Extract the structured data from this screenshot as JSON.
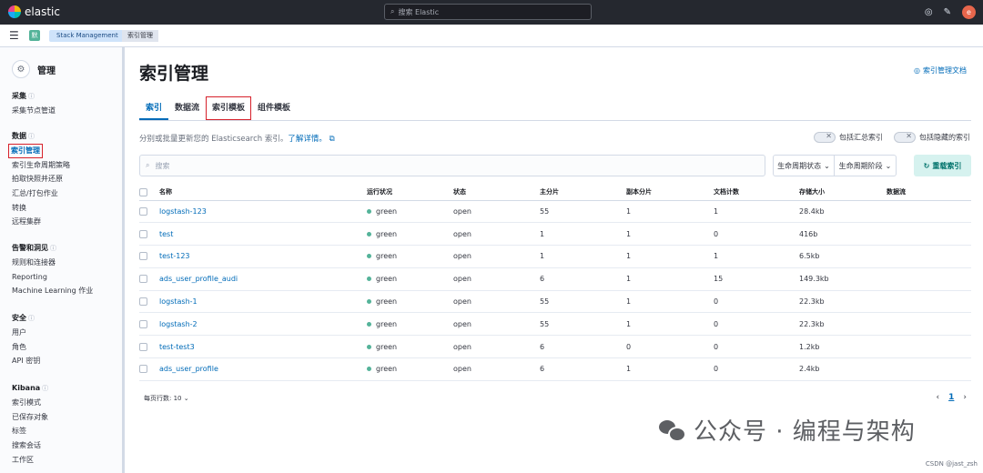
{
  "topbar": {
    "brand": "elastic",
    "search_placeholder": "搜索 Elastic",
    "avatar_letter": "e"
  },
  "breadcrumbs": {
    "space_badge": "默",
    "items": [
      "Stack Management",
      "索引管理"
    ]
  },
  "sidebar": {
    "title": "管理",
    "groups": [
      {
        "title": "采集",
        "items": [
          "采集节点管道"
        ]
      },
      {
        "title": "数据",
        "items": [
          "索引管理",
          "索引生命周期策略",
          "拍取快照并还原",
          "汇总/打包作业",
          "转换",
          "远程集群"
        ]
      },
      {
        "title": "告警和洞见",
        "items": [
          "规则和连接器",
          "Reporting",
          "Machine Learning 作业"
        ]
      },
      {
        "title": "安全",
        "items": [
          "用户",
          "角色",
          "API 密钥"
        ]
      },
      {
        "title": "Kibana",
        "items": [
          "索引模式",
          "已保存对象",
          "标签",
          "搜索会话",
          "工作区"
        ]
      }
    ]
  },
  "main": {
    "title": "索引管理",
    "doc_link": "索引管理文档",
    "tabs": [
      "索引",
      "数据流",
      "索引模板",
      "组件模板"
    ],
    "description": "分别或批量更新您的 Elasticsearch 索引。",
    "learn_more": "了解详情。",
    "toggle_rollup": "包括汇总索引",
    "toggle_hidden": "包括隐藏的索引",
    "search_placeholder": "搜索",
    "filter_phase": "生命周期状态",
    "filter_stage": "生命周期阶段",
    "reload_button": "重载索引"
  },
  "table": {
    "columns": [
      "名称",
      "运行状况",
      "状态",
      "主分片",
      "副本分片",
      "文档计数",
      "存储大小",
      "数据流"
    ],
    "rows": [
      [
        "logstash-123",
        "green",
        "open",
        "55",
        "1",
        "1",
        "28.4kb",
        ""
      ],
      [
        "test",
        "green",
        "open",
        "1",
        "1",
        "0",
        "416b",
        ""
      ],
      [
        "test-123",
        "green",
        "open",
        "1",
        "1",
        "1",
        "6.5kb",
        ""
      ],
      [
        "ads_user_profile_audi",
        "green",
        "open",
        "6",
        "1",
        "15",
        "149.3kb",
        ""
      ],
      [
        "logstash-1",
        "green",
        "open",
        "55",
        "1",
        "0",
        "22.3kb",
        ""
      ],
      [
        "logstash-2",
        "green",
        "open",
        "55",
        "1",
        "0",
        "22.3kb",
        ""
      ],
      [
        "test-test3",
        "green",
        "open",
        "6",
        "0",
        "0",
        "1.2kb",
        ""
      ],
      [
        "ads_user_profile",
        "green",
        "open",
        "6",
        "1",
        "0",
        "2.4kb",
        ""
      ]
    ]
  },
  "footer": {
    "rows_per_page": "每页行数: 10",
    "current_page": "1"
  },
  "watermark": {
    "text": "公众号 · 编程与架构",
    "csdn": "CSDN @jast_zsh"
  },
  "colors": {
    "accent": "#006bb8",
    "health_green": "#54b399",
    "highlight_box": "#d6212b"
  }
}
